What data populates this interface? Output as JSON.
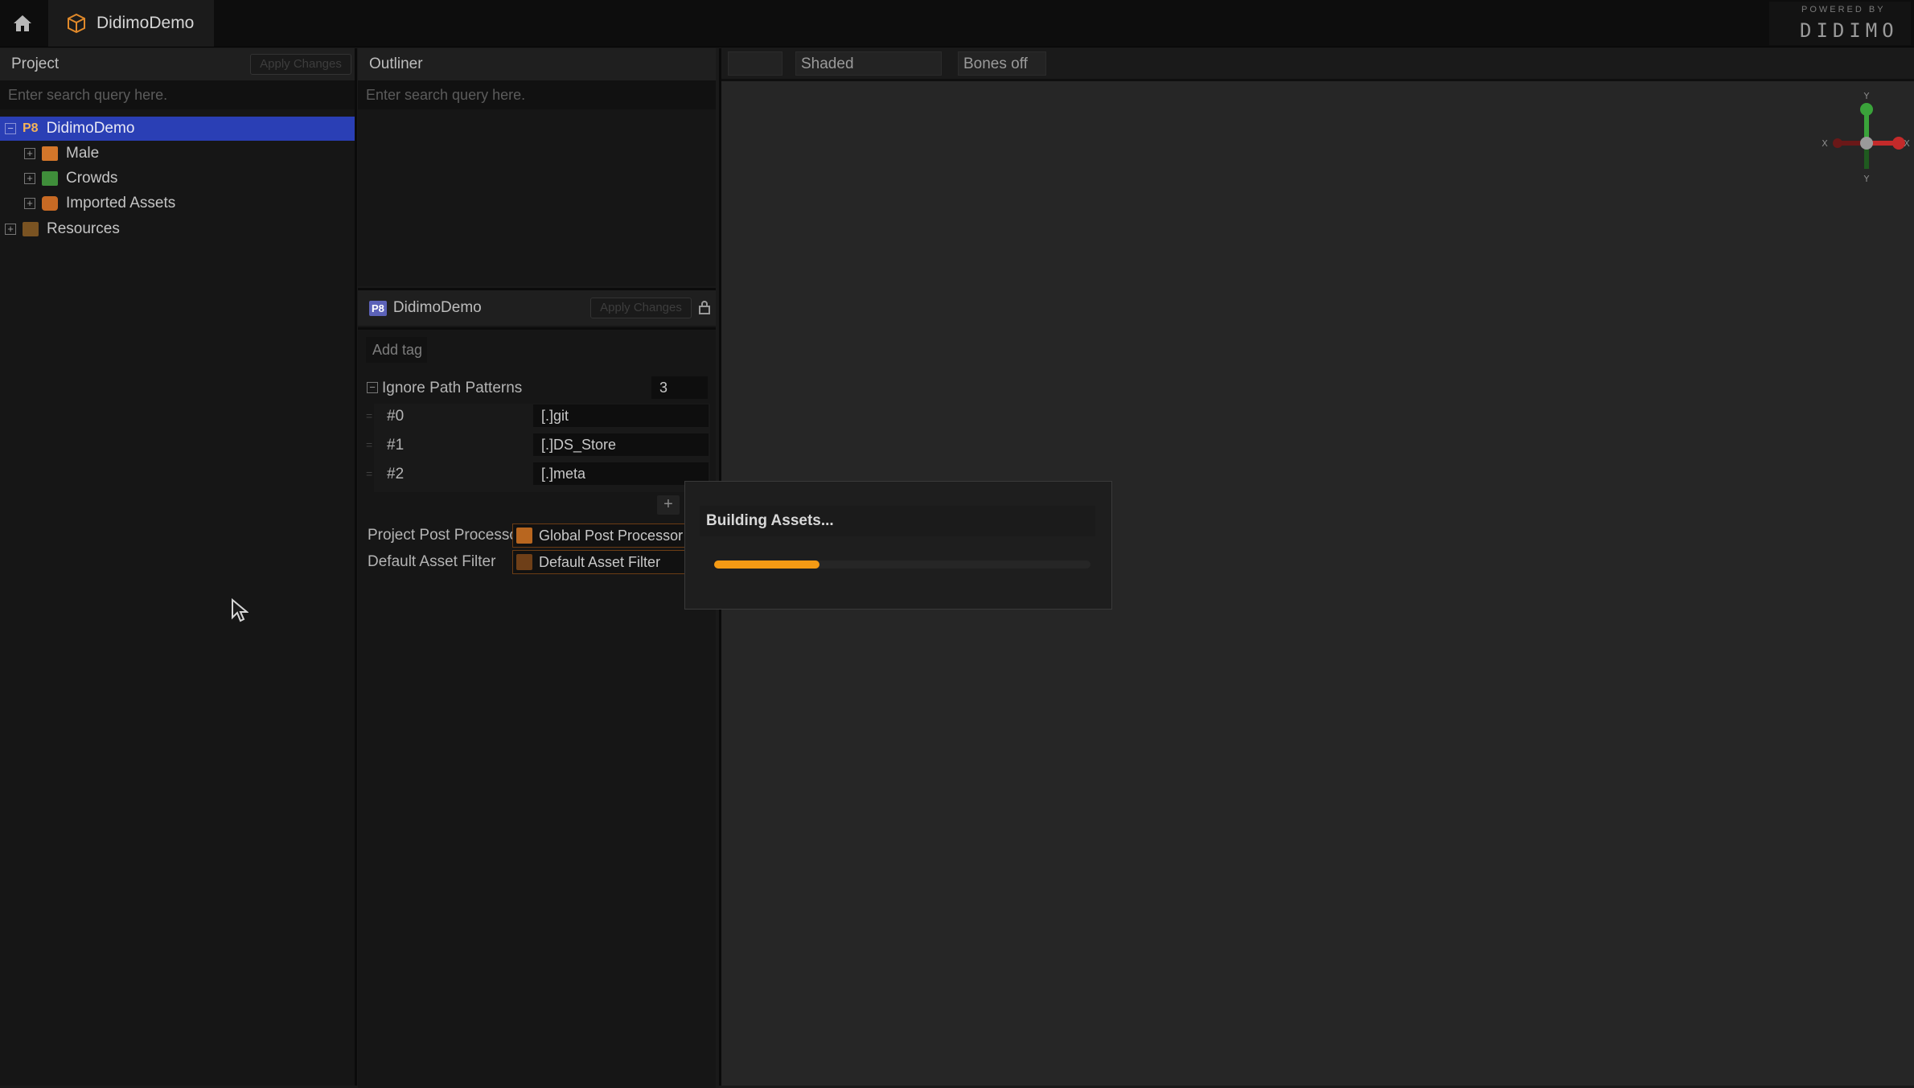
{
  "app": {
    "tab_title": "DidimoDemo"
  },
  "brand": {
    "powered_by": "POWERED BY",
    "logo_text": "DIDIMO"
  },
  "project": {
    "title": "Project",
    "apply_label": "Apply Changes",
    "search_placeholder": "Enter search query here.",
    "tree": [
      {
        "label": "DidimoDemo",
        "badge": "P8"
      },
      {
        "label": "Male"
      },
      {
        "label": "Crowds"
      },
      {
        "label": "Imported Assets"
      },
      {
        "label": "Resources"
      }
    ]
  },
  "outliner": {
    "title": "Outliner",
    "search_placeholder": "Enter search query here."
  },
  "inspector": {
    "badge": "P8",
    "title": "DidimoDemo",
    "apply_label": "Apply Changes",
    "add_tag": "Add tag",
    "ignore": {
      "label": "Ignore Path Patterns",
      "count": "3",
      "items": [
        {
          "index": "#0",
          "value": "[.]git"
        },
        {
          "index": "#1",
          "value": "[.]DS_Store"
        },
        {
          "index": "#2",
          "value": "[.]meta"
        }
      ]
    },
    "add_symbol": "+",
    "post_processor": {
      "label": "Project Post Processo",
      "value": "Global Post Processor"
    },
    "asset_filter": {
      "label": "Default Asset Filter",
      "value": "Default Asset Filter"
    }
  },
  "viewport": {
    "shading": "Shaded",
    "bones": "Bones off",
    "gizmo": {
      "x": "X",
      "y": "Y"
    }
  },
  "dialog": {
    "title": "Building Assets...",
    "progress": 0.28
  },
  "colors": {
    "accent": "#f49a14",
    "selection": "#2a3fb5"
  }
}
